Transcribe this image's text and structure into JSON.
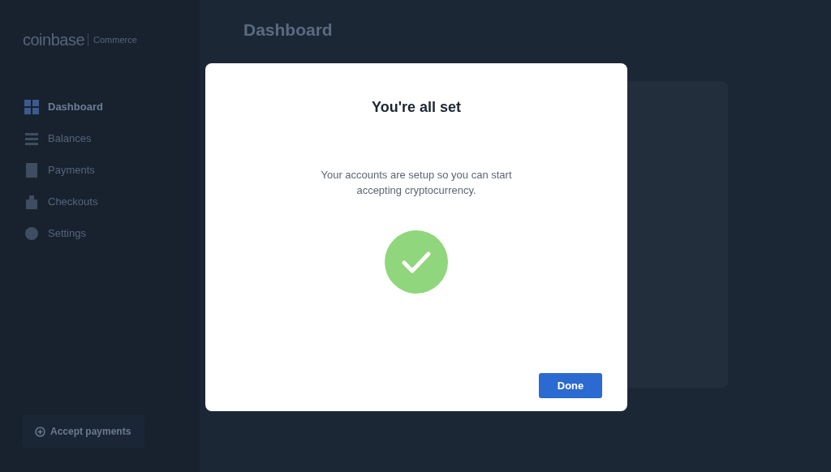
{
  "sidebar": {
    "logo": "coinbase",
    "logo_suffix": "Commerce",
    "items": [
      {
        "label": "Dashboard",
        "selected": true
      },
      {
        "label": "Balances",
        "selected": false
      },
      {
        "label": "Payments",
        "selected": false
      },
      {
        "label": "Checkouts",
        "selected": false
      },
      {
        "label": "Settings",
        "selected": false
      }
    ],
    "accept_button": "Accept payments"
  },
  "page": {
    "title": "Dashboard"
  },
  "modal": {
    "title": "You're all set",
    "message": "Your accounts are setup so you can start accepting cryptocurrency.",
    "button": "Done"
  }
}
